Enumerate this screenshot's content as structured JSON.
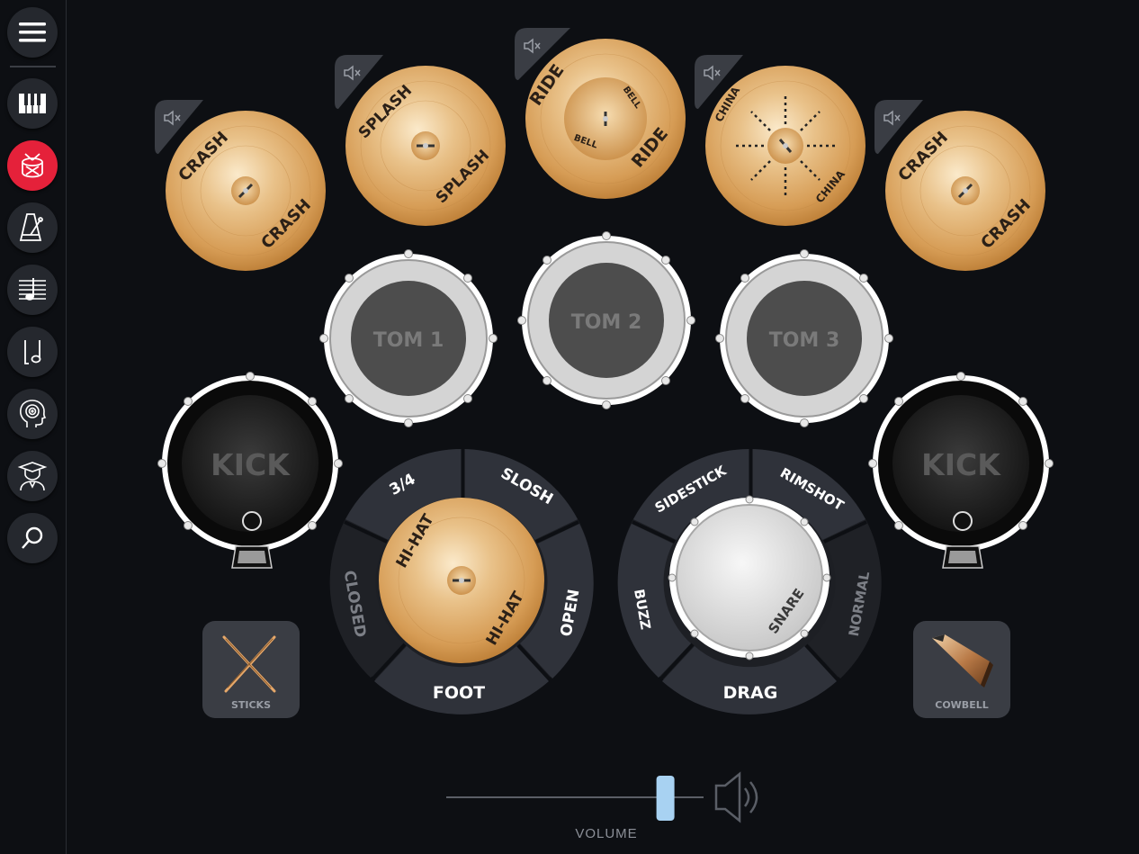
{
  "sidebar": {
    "menu_icon": "hamburger-menu-icon",
    "items": [
      {
        "name": "piano",
        "icon": "piano-keys-icon"
      },
      {
        "name": "drums",
        "icon": "drum-icon",
        "active": true
      },
      {
        "name": "metronome",
        "icon": "metronome-icon"
      },
      {
        "name": "sheet-music",
        "icon": "sheet-music-icon"
      },
      {
        "name": "note",
        "icon": "music-note-icon"
      },
      {
        "name": "ear-training",
        "icon": "head-target-icon"
      },
      {
        "name": "lessons",
        "icon": "graduate-icon"
      },
      {
        "name": "search",
        "icon": "search-icon"
      }
    ],
    "active_color": "#e5213a"
  },
  "cymbals": [
    {
      "id": "crash-left",
      "top_label": "CRASH",
      "bottom_label": "CRASH"
    },
    {
      "id": "splash",
      "top_label": "SPLASH",
      "bottom_label": "SPLASH"
    },
    {
      "id": "ride",
      "top_label": "RIDE",
      "bottom_label": "RIDE",
      "bell_top": "BELL",
      "bell_bottom": "BELL"
    },
    {
      "id": "china",
      "top_label": "CHINA",
      "bottom_label": "CHINA"
    },
    {
      "id": "crash-right",
      "top_label": "CRASH",
      "bottom_label": "CRASH"
    }
  ],
  "toms": [
    "TOM 1",
    "TOM 2",
    "TOM 3"
  ],
  "kicks": [
    "KICK",
    "KICK"
  ],
  "hihat": {
    "top_label": "HI-HAT",
    "bottom_label": "HI-HAT",
    "segments": {
      "three_quarter": "3/4",
      "slosh": "SLOSH",
      "open": "OPEN",
      "foot": "FOOT",
      "closed": "CLOSED"
    }
  },
  "snare": {
    "label": "SNARE",
    "segments": {
      "sidestick": "SIDESTICK",
      "rimshot": "RIMSHOT",
      "normal": "NORMAL",
      "drag": "DRAG",
      "buzz": "BUZZ"
    }
  },
  "sticks_label": "STICKS",
  "cowbell_label": "COWBELL",
  "volume": {
    "label": "VOLUME",
    "level": 0.85,
    "icon": "speaker-icon"
  },
  "mute_icon": "speaker-mute-icon"
}
